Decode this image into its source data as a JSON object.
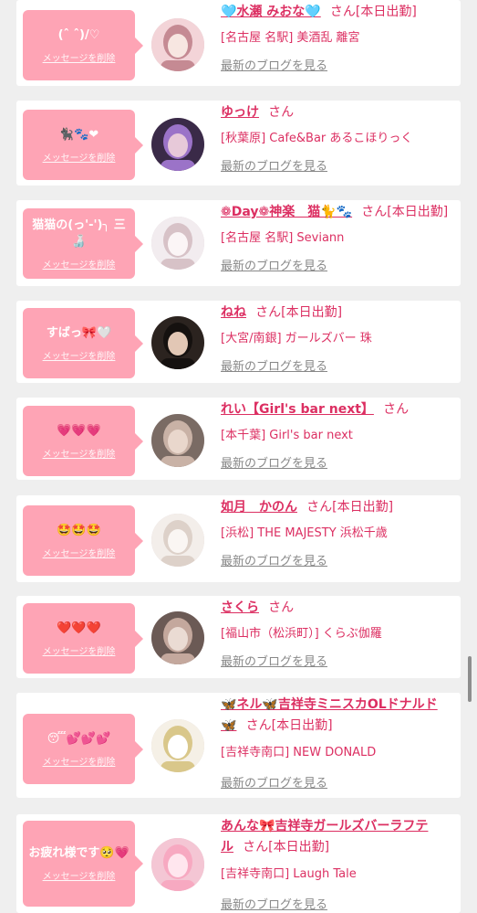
{
  "accent": "#dc2f62",
  "bubble_color": "#fea4b5",
  "delete_label": "メッセージを削除",
  "blog_label": "最新のブログを見る",
  "cards": [
    {
      "message": "(ˆ ˆ)/♡",
      "name": "🩵水瀬 みおな🩵",
      "suffix": "さん[本日出勤]",
      "shop": "[名古屋 名駅] 美酒乱 離宮"
    },
    {
      "message": "🐈‍⬛🐾❤",
      "name": "ゆっけ",
      "suffix": "さん",
      "shop": "[秋葉原] Cafe&Bar あるこほりっく"
    },
    {
      "message": "猫猫の(っ'-')╮ 三 🍶",
      "name": "❁Day❁神楽　猫🐈🐾",
      "suffix": "さん[本日出勤]",
      "shop": "[名古屋 名駅] Seviann"
    },
    {
      "message": "すばっ🎀🤍",
      "name": "ねね",
      "suffix": "さん[本日出勤]",
      "shop": "[大宮/南銀] ガールズバー 珠"
    },
    {
      "message": "💗💗💗",
      "name": "れい【Girl's bar next】",
      "suffix": "さん",
      "shop": "[本千葉] Girl's bar next"
    },
    {
      "message": "🤩🤩🤩",
      "name": "如月　かのん",
      "suffix": "さん[本日出勤]",
      "shop": "[浜松] THE MAJESTY 浜松千歳"
    },
    {
      "message": "❤️❤️❤️",
      "name": "さくら",
      "suffix": "さん",
      "shop": "[福山市（松浜町）] くらぶ伽羅"
    },
    {
      "message": "😴💕💕💕",
      "name": "🦋ネル🦋吉祥寺ミニスカOLドナルド🦋",
      "suffix": "さん[本日出勤]",
      "shop": "[吉祥寺南口] NEW DONALD"
    },
    {
      "message": "お疲れ様です🥺💗",
      "name": "あんな🎀吉祥寺ガールズバーラフテル",
      "suffix": "さん[本日出勤]",
      "shop": "[吉祥寺南口] Laugh Tale"
    }
  ]
}
